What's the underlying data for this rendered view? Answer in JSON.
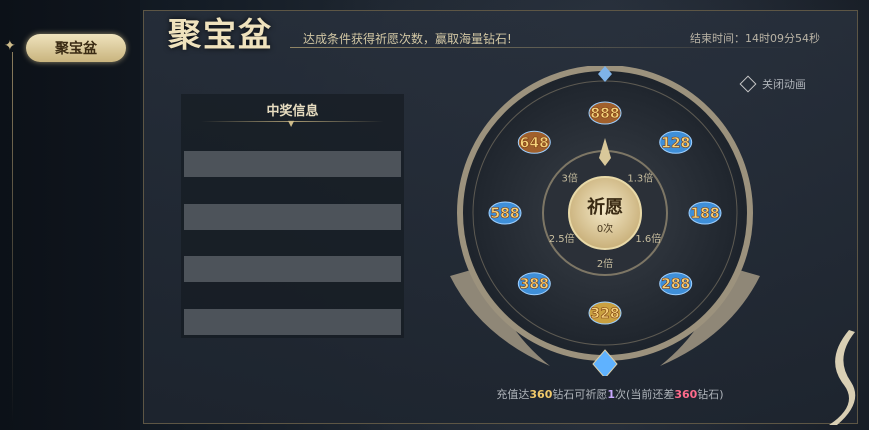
{
  "side_tab": {
    "label": "聚宝盆"
  },
  "header": {
    "title": "聚宝盆",
    "subtitle": "达成条件获得祈愿次数，赢取海量钻石!",
    "timer": "结束时间：14时09分54秒"
  },
  "controls": {
    "close_animation": "关闭动画"
  },
  "winners": {
    "title": "中奖信息",
    "rows": [
      "",
      "",
      "",
      ""
    ]
  },
  "wheel": {
    "center_label": "祈愿",
    "center_count": "0次",
    "prizes": [
      {
        "value": "888",
        "icon": "treasure-chest-icon"
      },
      {
        "value": "128",
        "icon": "diamond-pile-icon"
      },
      {
        "value": "188",
        "icon": "diamond-pile-icon"
      },
      {
        "value": "288",
        "icon": "diamond-pile-icon"
      },
      {
        "value": "328",
        "icon": "treasure-bowl-icon"
      },
      {
        "value": "388",
        "icon": "diamond-pile-icon"
      },
      {
        "value": "588",
        "icon": "diamond-pile-icon"
      },
      {
        "value": "648",
        "icon": "treasure-chest-icon"
      }
    ],
    "multipliers": [
      "1.3倍",
      "1.6倍",
      "2倍",
      "2.5倍",
      "3倍"
    ]
  },
  "footer": {
    "p1": "充值达",
    "amount": "360",
    "p2": "钻石可祈愿",
    "times": "1",
    "p3": "次(当前还差",
    "remaining": "360",
    "p4": "钻石)"
  },
  "colors": {
    "gold": "#f0c86a",
    "pink": "#ff6b8b",
    "accent_blue": "#5fb2ff"
  }
}
